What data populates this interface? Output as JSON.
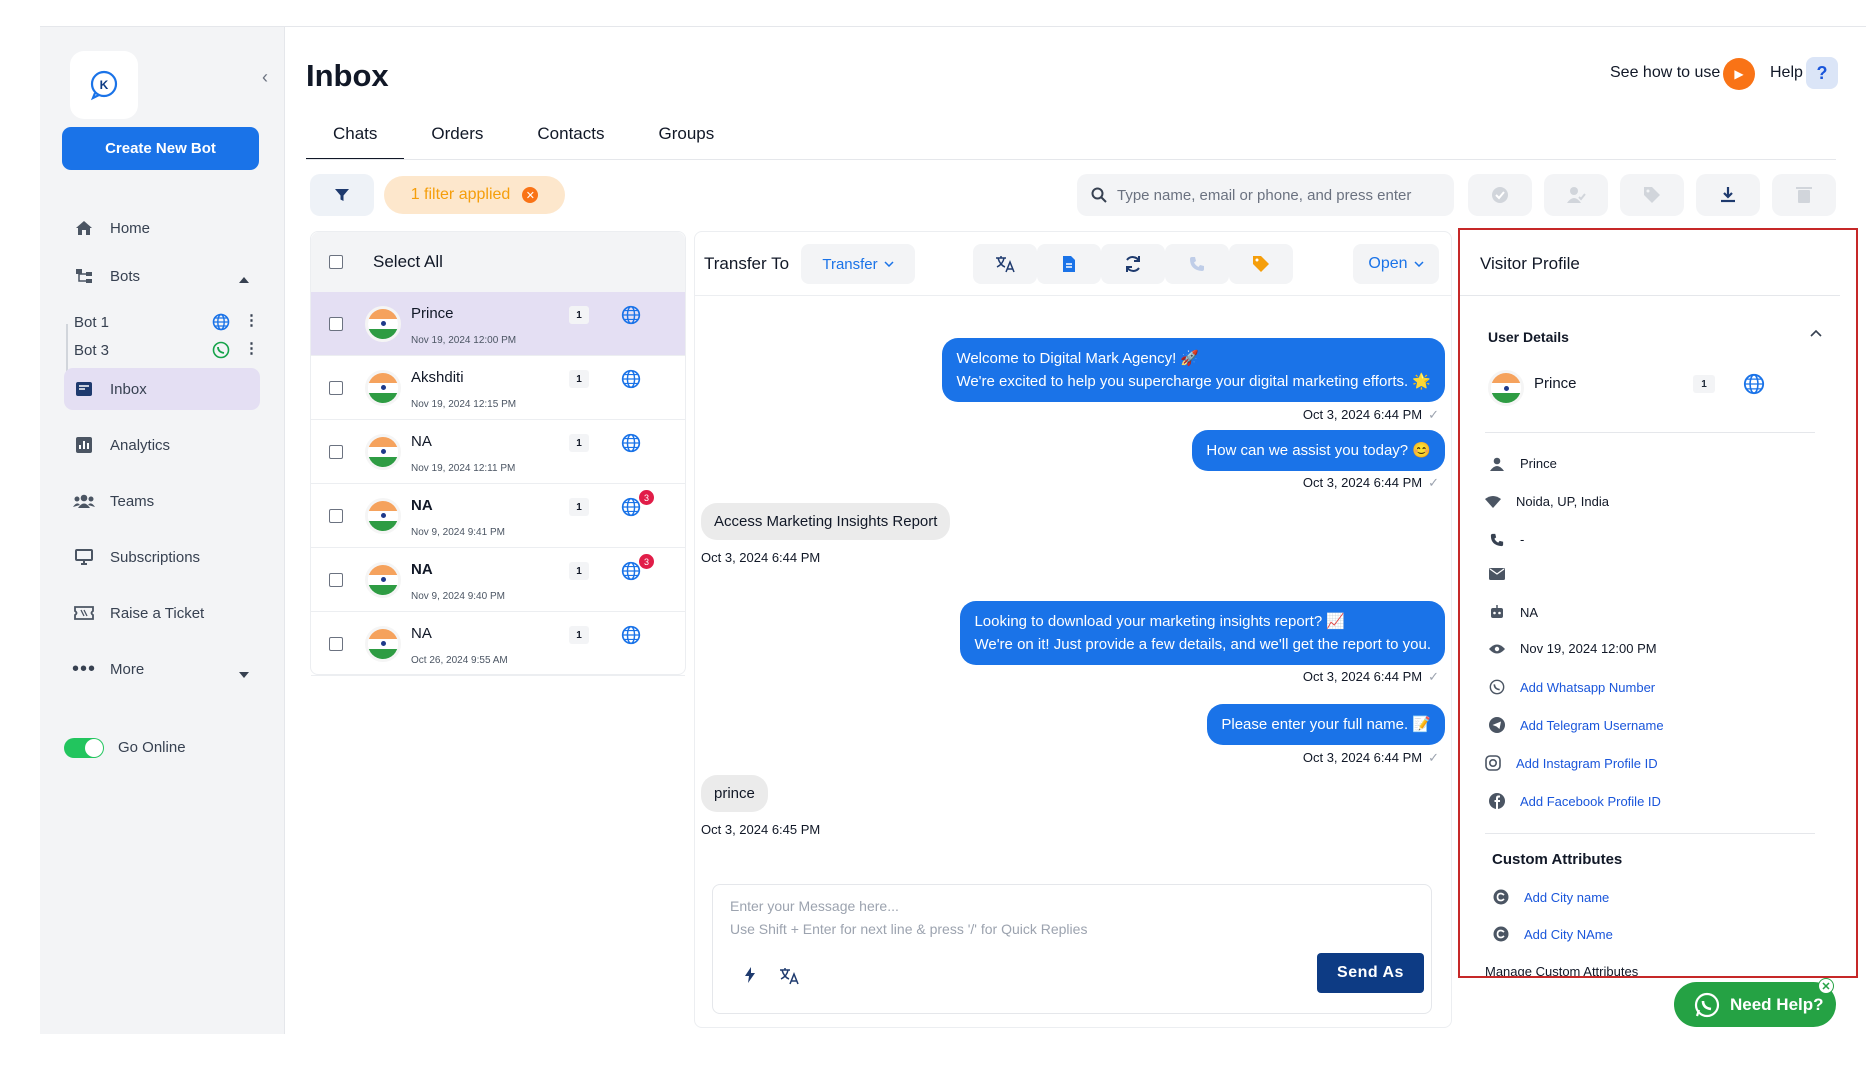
{
  "app": {
    "brand_letter": "K",
    "collapse_glyph": "‹"
  },
  "sidebar": {
    "create_button": "Create New Bot",
    "home": "Home",
    "bots": "Bots",
    "bot_list": [
      {
        "name": "Bot 1",
        "channel": "globe-icon"
      },
      {
        "name": "Bot 3",
        "channel": "whatsapp-icon"
      }
    ],
    "inbox": "Inbox",
    "analytics": "Analytics",
    "teams": "Teams",
    "subscriptions": "Subscriptions",
    "raise_ticket": "Raise a Ticket",
    "more": "More",
    "go_online": "Go Online"
  },
  "header": {
    "title": "Inbox",
    "see_how": "See how to use",
    "help": "Help",
    "help_glyph": "?",
    "tabs": [
      "Chats",
      "Orders",
      "Contacts",
      "Groups"
    ]
  },
  "toolbar": {
    "filter_chip": "1 filter applied",
    "search_placeholder": "Type name, email or phone, and press enter"
  },
  "chat_list": {
    "select_all": "Select All",
    "rows": [
      {
        "name": "Prince",
        "time": "Nov 19, 2024 12:00 PM",
        "count": "1",
        "badge": "",
        "bold": false
      },
      {
        "name": "Akshditi",
        "time": "Nov 19, 2024 12:15 PM",
        "count": "1",
        "badge": "",
        "bold": false
      },
      {
        "name": "NA",
        "time": "Nov 19, 2024 12:11 PM",
        "count": "1",
        "badge": "",
        "bold": false
      },
      {
        "name": "NA",
        "time": "Nov 9, 2024 9:41 PM",
        "count": "1",
        "badge": "3",
        "bold": true
      },
      {
        "name": "NA",
        "time": "Nov 9, 2024 9:40 PM",
        "count": "1",
        "badge": "3",
        "bold": true
      },
      {
        "name": "NA",
        "time": "Oct 26, 2024 9:55 AM",
        "count": "1",
        "badge": "",
        "bold": false
      }
    ]
  },
  "conversation": {
    "transfer_label": "Transfer To",
    "transfer_dropdown": "Transfer",
    "status_dropdown": "Open",
    "messages": {
      "m1_line1": "Welcome to Digital Mark Agency! 🚀",
      "m1_line2": "We're excited to help you supercharge your digital marketing efforts. 🌟",
      "m1_time": "Oct 3, 2024 6:44 PM",
      "m2": "How can we assist you today? 😊",
      "m2_time": "Oct 3, 2024 6:44 PM",
      "m3": "Access Marketing Insights Report",
      "m3_time": "Oct 3, 2024 6:44 PM",
      "m4_line1": "Looking to download your marketing insights report? 📈",
      "m4_line2": "We're on it! Just provide a few details, and we'll get the report to you.",
      "m4_time": "Oct 3, 2024 6:44 PM",
      "m5": "Please enter your full name. 📝",
      "m5_time": "Oct 3, 2024 6:44 PM",
      "m6": "prince",
      "m6_time": "Oct 3, 2024 6:45 PM"
    },
    "tick": "✓",
    "composer_placeholder": "Enter your Message here...\nUse Shift + Enter for next line & press '/' for Quick Replies",
    "send_button": "Send As"
  },
  "visitor_profile": {
    "title": "Visitor Profile",
    "user_details": "User Details",
    "name": "Prince",
    "count": "1",
    "details": {
      "user": "Prince",
      "location": "Noida, UP, India",
      "phone": "-",
      "email": "",
      "bot": "NA",
      "last_seen": "Nov 19, 2024 12:00 PM"
    },
    "links": {
      "whatsapp": "Add Whatsapp Number",
      "telegram": "Add Telegram Username",
      "instagram": "Add Instagram Profile ID",
      "facebook": "Add Facebook Profile ID"
    },
    "custom_attributes": "Custom Attributes",
    "attr_links": [
      "Add City name",
      "Add City NAme"
    ],
    "manage": "Manage Custom Attributes"
  },
  "need_help": {
    "label": "Need Help?",
    "close_glyph": "✕"
  },
  "colors": {
    "primary": "#1a73e8",
    "send": "#0d3b84",
    "highlight_border": "#c62828",
    "whatsapp": "#25a244",
    "active_row": "#e4dff3"
  }
}
